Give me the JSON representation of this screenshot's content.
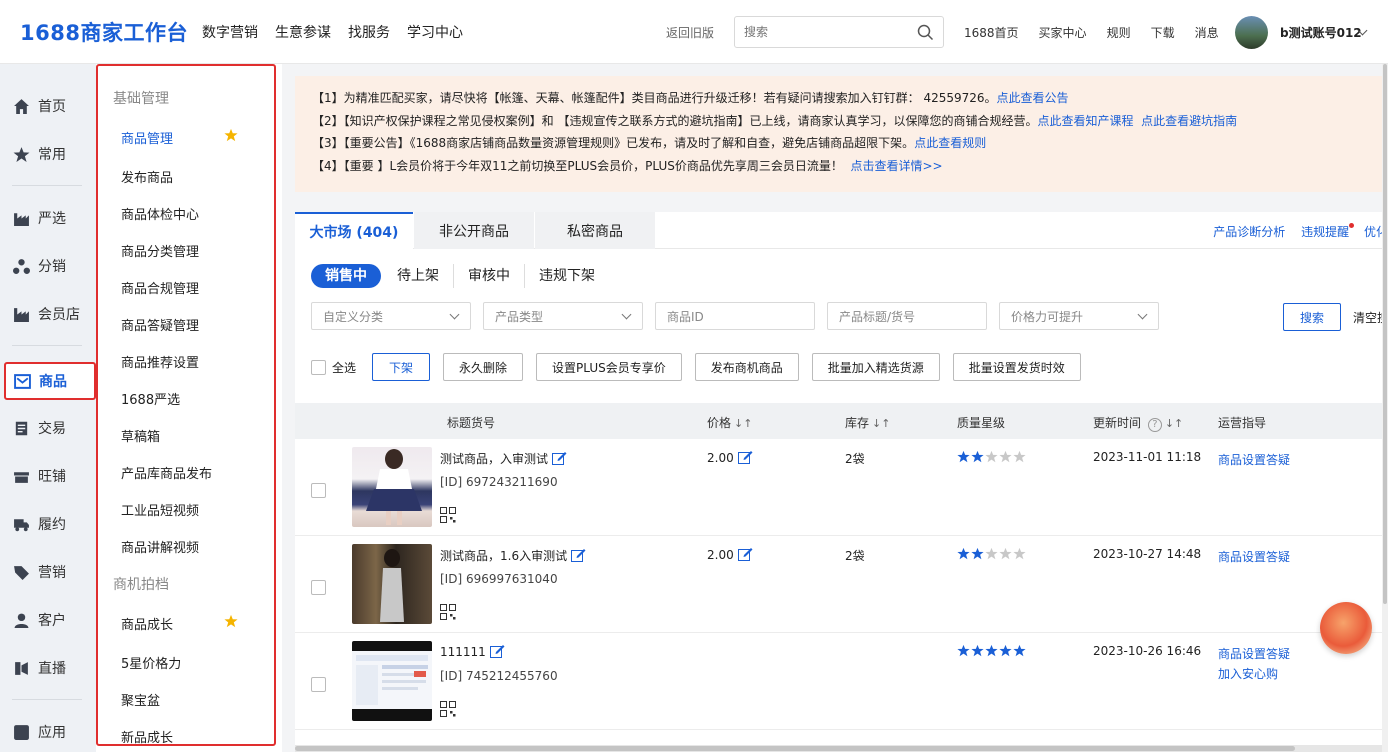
{
  "header": {
    "logo": "1688商家工作台",
    "nav": [
      "数字营销",
      "生意参谋",
      "找服务",
      "学习中心"
    ],
    "old_version": "返回旧版",
    "search_placeholder": "搜索",
    "links": [
      "1688首页",
      "买家中心",
      "规则",
      "下载",
      "消息"
    ],
    "username": "b测试账号012"
  },
  "leftnav": {
    "items": [
      {
        "label": "首页",
        "icon": "home-icon"
      },
      {
        "label": "常用",
        "icon": "star-icon"
      },
      {
        "label": "严选",
        "icon": "factory-icon"
      },
      {
        "label": "分销",
        "icon": "distribution-icon"
      },
      {
        "label": "会员店",
        "icon": "shop-icon"
      },
      {
        "label": "商品",
        "icon": "goods-icon"
      },
      {
        "label": "交易",
        "icon": "trade-icon"
      },
      {
        "label": "旺铺",
        "icon": "store-icon"
      },
      {
        "label": "履约",
        "icon": "truck-icon"
      },
      {
        "label": "营销",
        "icon": "tag-icon"
      },
      {
        "label": "客户",
        "icon": "user-icon"
      },
      {
        "label": "直播",
        "icon": "live-icon"
      },
      {
        "label": "应用",
        "icon": "apps-icon"
      }
    ],
    "active": "商品"
  },
  "subnav": {
    "section1": "基础管理",
    "items1": [
      "商品管理",
      "发布商品",
      "商品体检中心",
      "商品分类管理",
      "商品合规管理",
      "商品答疑管理",
      "商品推荐设置",
      "1688严选",
      "草稿箱",
      "产品库商品发布",
      "工业品短视频",
      "商品讲解视频"
    ],
    "section2": "商机拍档",
    "items2": [
      "商品成长",
      "5星价格力",
      "聚宝盆",
      "新品成长"
    ]
  },
  "notices": [
    {
      "text": "【1】为精准匹配买家，请尽快将【帐篷、天幕、帐篷配件】类目商品进行升级迁移！若有疑问请搜索加入钉钉群： 42559726。",
      "links": [
        "点此查看公告"
      ]
    },
    {
      "text": "【2】【知识产权保护课程之常见侵权案例】和 【违规宣传之联系方式的避坑指南】已上线，请商家认真学习，以保障您的商铺合规经营。",
      "links": [
        "点此查看知产课程",
        "点此查看避坑指南"
      ]
    },
    {
      "text": "【3】【重要公告】《1688商家店铺商品数量资源管理规则》已发布，请及时了解和自查，避免店铺商品超限下架。",
      "links": [
        "点此查看规则"
      ]
    },
    {
      "text": "【4】【重要    】L会员价将于今年双11之前切换至PLUS会员价，PLUS价商品优先享周三会员日流量！",
      "links": [
        "点击查看详情>>"
      ]
    }
  ],
  "tabs": [
    {
      "label": "大市场 (404)",
      "active": true
    },
    {
      "label": "非公开商品",
      "active": false
    },
    {
      "label": "私密商品",
      "active": false
    }
  ],
  "right_links": [
    "产品诊断分析",
    "违规提醒",
    "优化"
  ],
  "status_pills": [
    {
      "label": "销售中",
      "active": true
    },
    {
      "label": "待上架",
      "active": false
    },
    {
      "label": "审核中",
      "active": false
    },
    {
      "label": "违规下架",
      "active": false
    }
  ],
  "filters": {
    "custom_category": "自定义分类",
    "product_type": "产品类型",
    "product_id": "商品ID",
    "title_sku": "产品标题/货号",
    "price_power": "价格力可提升",
    "search_btn": "搜索",
    "clear": "清空搜"
  },
  "actions": {
    "select_all": "全选",
    "buttons": [
      "下架",
      "永久删除",
      "设置PLUS会员专享价",
      "发布商机商品",
      "批量加入精选货源",
      "批量设置发货时效"
    ]
  },
  "table": {
    "headers": {
      "title": "标题货号",
      "price": "价格",
      "stock": "库存",
      "quality": "质量星级",
      "updated": "更新时间",
      "ops": "运营指导"
    },
    "rows": [
      {
        "name": "测试商品，入审测试",
        "id": "[ID] 697243211690",
        "price": "2.00",
        "stock": "2袋",
        "stars": 2,
        "time": "2023-11-01 11:18",
        "ops": [
          "商品设置答疑"
        ]
      },
      {
        "name": "测试商品，1.6入审测试",
        "id": "[ID] 696997631040",
        "price": "2.00",
        "stock": "2袋",
        "stars": 2,
        "time": "2023-10-27 14:48",
        "ops": [
          "商品设置答疑"
        ]
      },
      {
        "name": "111111",
        "id": "[ID] 745212455760",
        "price": "",
        "stock": "",
        "stars": 5,
        "time": "2023-10-26 16:46",
        "ops": [
          "商品设置答疑",
          "加入安心购"
        ]
      }
    ]
  },
  "colors": {
    "accent": "#1a5fd6",
    "highlight": "#e02e2e",
    "star": "#f5b400"
  }
}
